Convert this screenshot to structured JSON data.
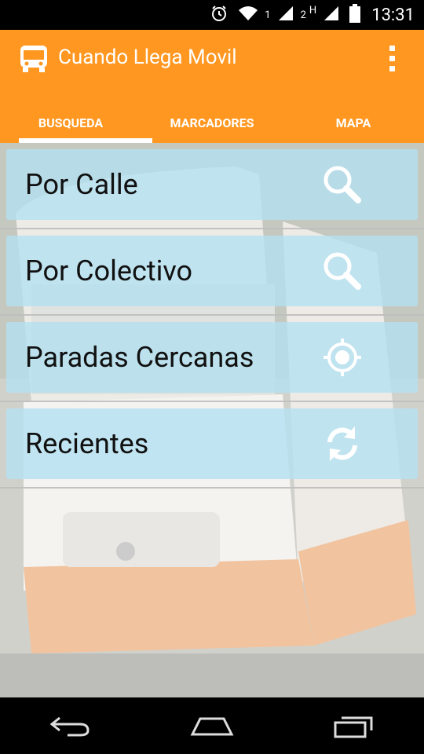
{
  "status_bar": {
    "time": "13:31",
    "sim1_label": "1",
    "sim2_label": "2",
    "network_label": "H",
    "icons": [
      "alarm-icon",
      "wifi-icon",
      "signal-icon",
      "signal-icon",
      "battery-icon"
    ]
  },
  "app": {
    "title": "Cuando Llega Movil",
    "icon": "bus-icon",
    "brand_color": "#FF9720"
  },
  "tabs": [
    {
      "label": "BUSQUEDA",
      "selected": true
    },
    {
      "label": "MARCADORES",
      "selected": false
    },
    {
      "label": "MAPA",
      "selected": false
    }
  ],
  "search_options": [
    {
      "label": "Por Calle",
      "icon": "search-icon"
    },
    {
      "label": "Por Colectivo",
      "icon": "search-icon"
    },
    {
      "label": "Paradas Cercanas",
      "icon": "location-target-icon"
    },
    {
      "label": "Recientes",
      "icon": "refresh-icon"
    }
  ],
  "nav": {
    "buttons": [
      "back-icon",
      "home-icon",
      "recent-apps-icon"
    ]
  }
}
